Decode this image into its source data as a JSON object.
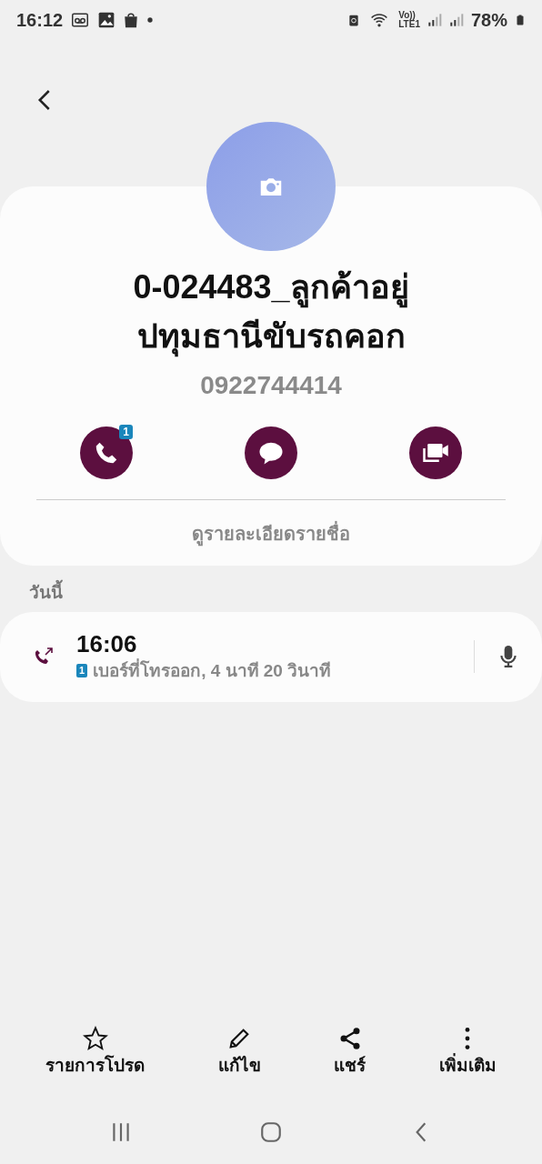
{
  "status_bar": {
    "time": "16:12",
    "volte": "Vo))",
    "network": "LTE1",
    "battery": "78%"
  },
  "contact": {
    "name": "0-024483_ลูกค้าอยู่\nปทุมธานีขับรถคอก",
    "phone": "0922744414"
  },
  "actions": [
    {
      "kind": "call",
      "badge": "1"
    },
    {
      "kind": "message"
    },
    {
      "kind": "video"
    }
  ],
  "details_link": "ดูรายละเอียดรายชื่อ",
  "section": "วันนี้",
  "call_log": [
    {
      "kind": "outgoing",
      "time": "16:06",
      "sim": "1",
      "description": "เบอร์ที่โทรออก, 4 นาที 20 วินาที"
    }
  ],
  "toolbar": [
    {
      "kind": "star",
      "label": "รายการโปรด"
    },
    {
      "kind": "edit",
      "label": "แก้ไข"
    },
    {
      "kind": "share",
      "label": "แชร์"
    },
    {
      "kind": "more",
      "label": "เพิ่มเติม"
    }
  ]
}
